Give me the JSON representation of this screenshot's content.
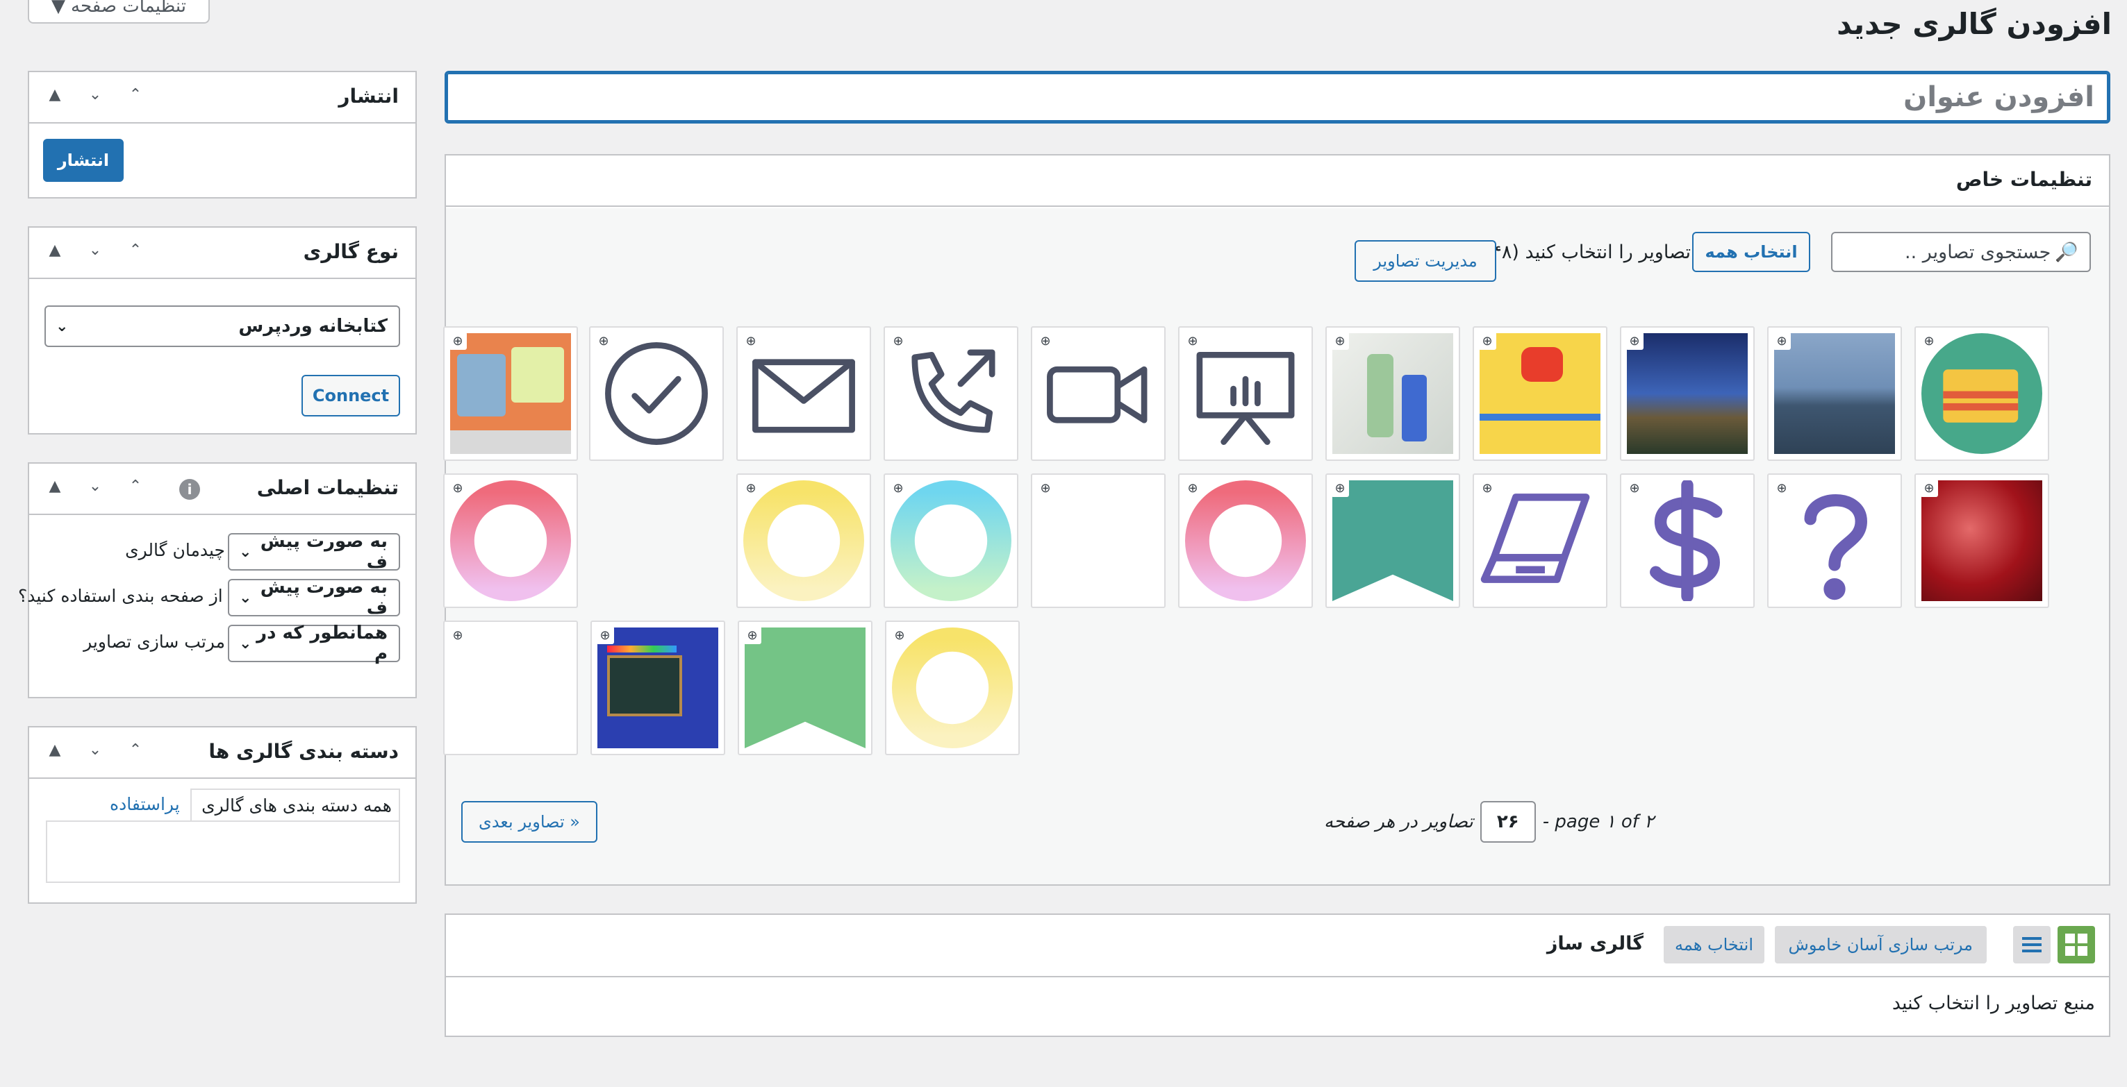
{
  "screen_options": "تنظیمات صفحه",
  "page_title": "افزودن گالری جدید",
  "title_placeholder": "افزودن عنوان",
  "publish_box": {
    "title": "انتشار",
    "button": "انتشار"
  },
  "gallery_type_box": {
    "title": "نوع گالری",
    "select_value": "کتابخانه وردپرس",
    "connect_button": "Connect"
  },
  "main_settings_box": {
    "title": "تنظیمات اصلی",
    "rows": [
      {
        "label": "چیدمان گالری",
        "value": "به صورت پیش ف"
      },
      {
        "label": "از صفحه بندی استفاده کنید؟",
        "value": "به صورت پیش ف"
      },
      {
        "label": "مرتب سازی تصاویر",
        "value": "همانطور که در م"
      }
    ]
  },
  "categories_box": {
    "title": "دسته بندی گالری ها",
    "field_value": "همه دسته بندی های گالری",
    "most_used_link": "پراستفاده"
  },
  "special_settings": {
    "title": "تنظیمات خاص",
    "search_placeholder": "جستجوی تصاویر ..",
    "select_all_button": "انتخاب همه",
    "choose_text": "تصاویر را انتخاب کنید",
    "count": "(۴۸)",
    "manage_button": "مدیریت تصاویر",
    "pagination": {
      "page_text": "- page ۱ of ۲",
      "per_page_value": "۲۶",
      "per_page_label": "تصاویر در هر صفحه",
      "next_button": "تصاویر بعدی »"
    }
  },
  "gallery_builder": {
    "title": "گالری ساز",
    "select_all_button": "انتخاب همه",
    "sort_button": "مرتب سازی آسان خاموش",
    "empty_text": "منبع تصاویر را انتخاب کنید"
  },
  "colors": {
    "accent": "#2271b1",
    "grid_view_active": "#6aa84f",
    "background": "#f0f0f1"
  }
}
